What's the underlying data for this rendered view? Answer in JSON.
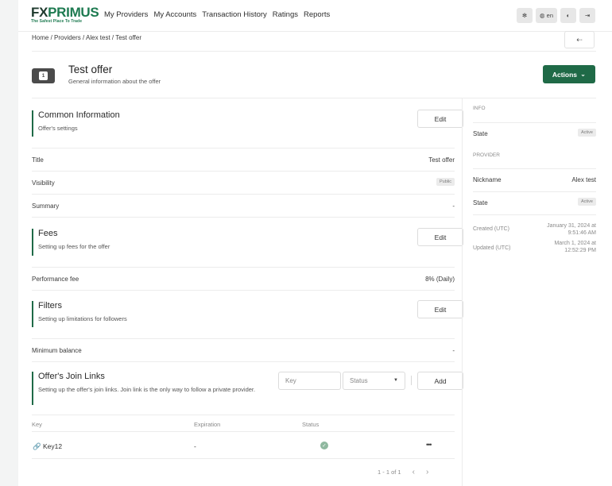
{
  "nav": {
    "logo_main": "FX",
    "logo_accent": "PRIMUS",
    "logo_tagline": "The Safest Place To Trade",
    "links": [
      "My Providers",
      "My Accounts",
      "Transaction History",
      "Ratings",
      "Reports"
    ],
    "language_label": "en"
  },
  "breadcrumb": "Home / Providers / Alex test / Test offer",
  "header": {
    "title": "Test offer",
    "subtitle": "General information about the offer",
    "actions_label": "Actions"
  },
  "common": {
    "title": "Common Information",
    "desc": "Offer's settings",
    "edit_label": "Edit",
    "rows": [
      {
        "label": "Title",
        "value": "Test offer"
      },
      {
        "label": "Visibility",
        "badge": "Public"
      },
      {
        "label": "Summary",
        "value": "-"
      }
    ]
  },
  "fees": {
    "title": "Fees",
    "desc": "Setting up fees for the offer",
    "edit_label": "Edit",
    "rows": [
      {
        "label": "Performance fee",
        "value": "8% (Daily)"
      }
    ]
  },
  "filters": {
    "title": "Filters",
    "desc": "Setting up limitations for followers",
    "edit_label": "Edit",
    "rows": [
      {
        "label": "Minimum balance",
        "value": "-"
      }
    ]
  },
  "links": {
    "title": "Offer's Join Links",
    "desc": "Setting up the offer's join links. Join link is the only way to follow a private provider.",
    "key_placeholder": "Key",
    "status_placeholder": "Status",
    "add_label": "Add",
    "columns": [
      "Key",
      "Expiration",
      "Status"
    ],
    "rows": [
      {
        "key": "Key12",
        "expiration": "-",
        "status": "active"
      }
    ],
    "pager": "1 - 1 of 1"
  },
  "sidebar": {
    "info_heading": "INFO",
    "state_label": "State",
    "state_value": "Active",
    "provider_heading": "PROVIDER",
    "nickname_label": "Nickname",
    "nickname_value": "Alex test",
    "provider_state_label": "State",
    "provider_state_value": "Active",
    "created_label": "Created (UTC)",
    "created_value": "January 31, 2024 at 9:51:46 AM",
    "updated_label": "Updated (UTC)",
    "updated_value": "March 1, 2024 at 12:52:29 PM"
  },
  "colors": {
    "accent": "#1f6a47",
    "page_bg": "#f3f4f4"
  }
}
